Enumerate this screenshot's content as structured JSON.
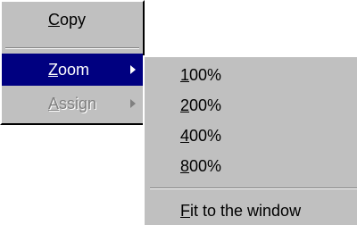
{
  "main_menu": {
    "items": [
      {
        "label_mnemonic": "C",
        "label_rest": "opy",
        "state": "normal"
      },
      {
        "label_mnemonic": "Z",
        "label_rest": "oom",
        "state": "highlighted",
        "submenu_arrow": "triangle-right-icon"
      },
      {
        "label_mnemonic": "A",
        "label_rest": "ssign",
        "state": "disabled",
        "submenu_arrow": "triangle-right-icon"
      }
    ]
  },
  "zoom_submenu": {
    "items": [
      {
        "label_mnemonic": "1",
        "label_rest": "00%"
      },
      {
        "label_mnemonic": "2",
        "label_rest": "00%"
      },
      {
        "label_mnemonic": "4",
        "label_rest": "00%"
      },
      {
        "label_mnemonic": "8",
        "label_rest": "00%"
      },
      {
        "label_mnemonic": "F",
        "label_rest": "it to the window"
      }
    ]
  },
  "colors": {
    "menu_face": "#c0c0c0",
    "highlight": "#000080",
    "highlight_text": "#ffffff",
    "disabled_text": "#808080"
  }
}
